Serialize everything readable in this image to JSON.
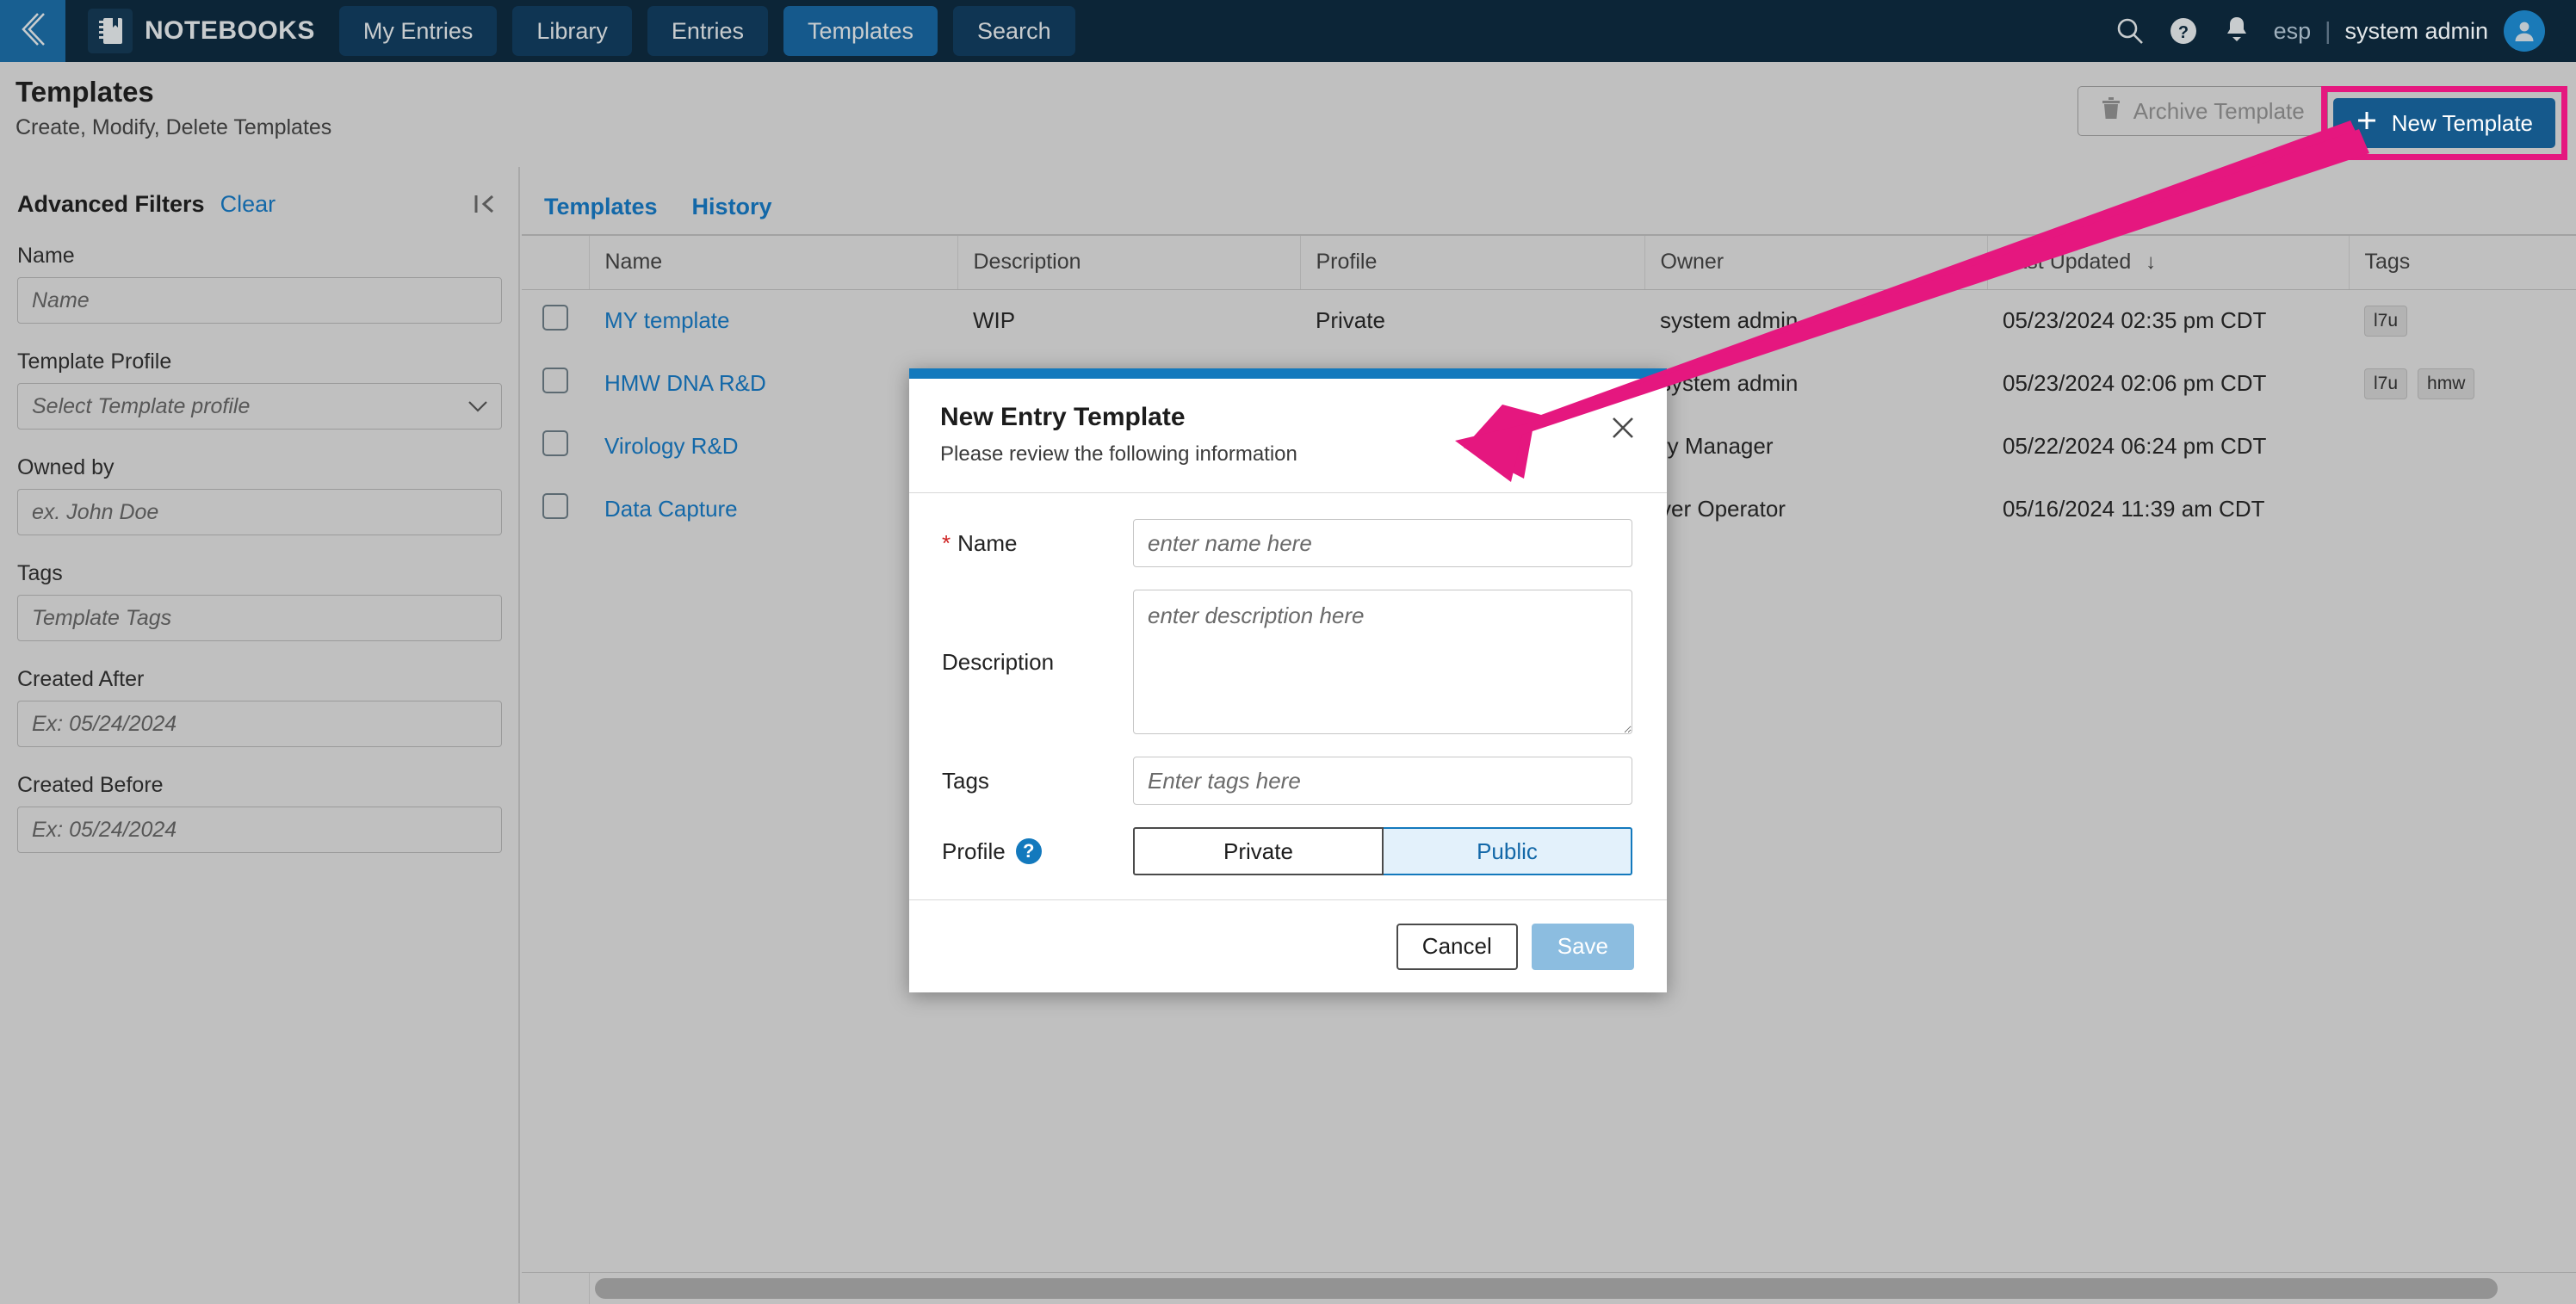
{
  "accent": {
    "navbar_bg": "#0c2537",
    "nav_active": "#15598c",
    "link_blue": "#1368a8",
    "annotation_pink": "#e5177f",
    "page_bg": "#c0c0c0",
    "modal_topbar": "#1379bd",
    "save_disabled": "#8cbde0"
  },
  "topnav": {
    "back_icon": "chevron-double-left-icon",
    "brand_icon": "notebook-icon",
    "brand_name": "NOTEBOOKS",
    "tabs": [
      {
        "label": "My Entries",
        "active": false
      },
      {
        "label": "Library",
        "active": false
      },
      {
        "label": "Entries",
        "active": false
      },
      {
        "label": "Templates",
        "active": true
      },
      {
        "label": "Search",
        "active": false
      }
    ],
    "search_icon": "search-icon",
    "help_icon": "help-circle-icon",
    "notifications_icon": "bell-icon",
    "language": "esp",
    "divider": "|",
    "username": "system admin",
    "avatar_icon": "user-avatar-icon"
  },
  "pagehead": {
    "title": "Templates",
    "subtitle": "Create, Modify, Delete Templates",
    "archive_label": "Archive Template",
    "archive_icon": "trash-icon",
    "new_label": "New Template",
    "new_icon": "plus-icon"
  },
  "sidebar": {
    "title": "Advanced Filters",
    "clear_label": "Clear",
    "collapse_icon": "collapse-left-icon",
    "fields": [
      {
        "label": "Name",
        "placeholder": "Name",
        "type": "text"
      },
      {
        "label": "Template Profile",
        "placeholder": "Select Template profile",
        "type": "select"
      },
      {
        "label": "Owned by",
        "placeholder": "ex. John Doe",
        "type": "text"
      },
      {
        "label": "Tags",
        "placeholder": "Template Tags",
        "type": "text"
      },
      {
        "label": "Created After",
        "placeholder": "Ex: 05/24/2024",
        "type": "text"
      },
      {
        "label": "Created Before",
        "placeholder": "Ex: 05/24/2024",
        "type": "text"
      }
    ]
  },
  "main": {
    "tabs": [
      {
        "label": "Templates",
        "active": true
      },
      {
        "label": "History",
        "active": false
      }
    ],
    "table": {
      "columns": [
        "Name",
        "Description",
        "Profile",
        "Owner",
        "Last Updated",
        "Tags"
      ],
      "sorted_column": "Last Updated",
      "sort_direction": "↓",
      "rows": [
        {
          "checked": false,
          "name": "MY template",
          "description": "WIP",
          "profile": "Private",
          "owner": "system admin",
          "last_updated": "05/23/2024 02:35 pm CDT",
          "tags": [
            "l7u"
          ]
        },
        {
          "checked": false,
          "name": "HMW DNA R&D",
          "description": "",
          "profile": "",
          "owner": "system admin",
          "last_updated": "05/23/2024 02:06 pm CDT",
          "tags": [
            "l7u",
            "hmw"
          ]
        },
        {
          "checked": false,
          "name": "Virology R&D",
          "description": "",
          "profile": "",
          "owner": "ry Manager",
          "last_updated": "05/22/2024 06:24 pm CDT",
          "tags": []
        },
        {
          "checked": false,
          "name": "Data Capture",
          "description": "",
          "profile": "",
          "owner": "ver Operator",
          "last_updated": "05/16/2024 11:39 am CDT",
          "tags": []
        }
      ]
    }
  },
  "modal": {
    "title": "New Entry Template",
    "subtitle": "Please review the following information",
    "close_icon": "close-icon",
    "name_label": "Name",
    "name_required": "*",
    "name_placeholder": "enter name here",
    "name_value": "",
    "description_label": "Description",
    "description_placeholder": "enter description here",
    "description_value": "",
    "tags_label": "Tags",
    "tags_placeholder": "Enter tags here",
    "tags_value": "",
    "profile_label": "Profile",
    "profile_help_icon": "help-circle-icon",
    "profile_help_glyph": "?",
    "profile_options": [
      {
        "label": "Private",
        "selected": false
      },
      {
        "label": "Public",
        "selected": true
      }
    ],
    "cancel_label": "Cancel",
    "save_label": "Save"
  }
}
